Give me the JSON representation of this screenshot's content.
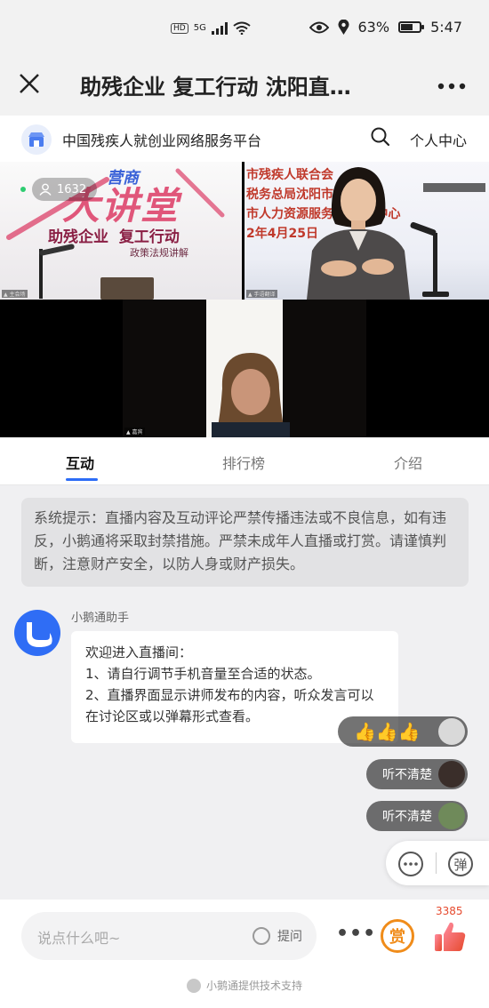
{
  "status_bar": {
    "hd": "HD",
    "network": "5G",
    "battery_percent": "63%",
    "battery_level": 0.63,
    "time": "5:47"
  },
  "title_bar": {
    "title": "助残企业 复工行动 沈阳直…"
  },
  "platform_bar": {
    "name": "中国残疾人就创业网络服务平台",
    "personal_center": "个人中心"
  },
  "video": {
    "viewer_count": "1632",
    "tile1": {
      "brand": "营商",
      "headline": "大讲堂",
      "slogan": "助残企业  复工行动",
      "subtitle": "政策法规讲解"
    },
    "tile2": {
      "line1": "市残疾人联合会",
      "line2": "税务总局沈阳市",
      "line3": "市人力资源服务    执法中心",
      "line4": "2年4月25日"
    }
  },
  "tabs": [
    "互动",
    "排行榜",
    "介绍"
  ],
  "notice": "系统提示：直播内容及互动评论严禁传播违法或不良信息，如有违反，小鹅通将采取封禁措施。严禁未成年人直播或打赏。请谨慎判断，注意财产安全，以防人身或财产损失。",
  "assistant": {
    "name": "小鹅通助手",
    "message_lines": [
      "欢迎进入直播间：",
      "1、请自行调节手机音量至合适的状态。",
      "2、直播界面显示讲师发布的内容，听众发言可以在讨论区或以弹幕形式查看。"
    ]
  },
  "danmaku": [
    {
      "text": "👍👍👍"
    },
    {
      "text": "听不清楚"
    },
    {
      "text": "听不清楚"
    }
  ],
  "danmu_toggle_label": "弹",
  "bottom_bar": {
    "input_placeholder": "说点什么吧~",
    "ask_label": "提问",
    "more": "•••",
    "reward_label": "赏",
    "like_count": "3385",
    "powered_by": "小鹅通提供技术支持"
  },
  "colors": {
    "accent": "#2c6cf6",
    "reward": "#f08c1a",
    "like": "#e6492d"
  }
}
